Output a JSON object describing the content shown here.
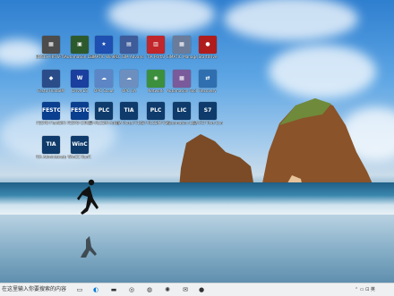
{
  "desktop": {
    "icons": [
      {
        "name": "desktop-icon-1",
        "label": "BOSCH-IRTW-TIA-0",
        "glyph": "▦",
        "color": "#4c4c4c"
      },
      {
        "name": "desktop-icon-2",
        "label": "Automation License",
        "glyph": "▣",
        "color": "#2d5a2d"
      },
      {
        "name": "desktop-icon-3",
        "label": "SIMATIC WinCC",
        "glyph": "★",
        "color": "#1f4fb0"
      },
      {
        "name": "desktop-icon-4",
        "label": "PLC SIM Advanced",
        "glyph": "▤",
        "color": "#3e5b9a"
      },
      {
        "name": "desktop-icon-5",
        "label": "TIA Portal",
        "glyph": "▥",
        "color": "#c0262a"
      },
      {
        "name": "desktop-icon-6",
        "label": "SIMATIC Manager",
        "glyph": "▦",
        "color": "#6b7c9a"
      },
      {
        "name": "desktop-icon-7",
        "label": "Startdrive",
        "glyph": "●",
        "color": "#b01c1c"
      },
      {
        "name": "desktop-icon-8",
        "label": "Festo FluidSIM",
        "glyph": "◆",
        "color": "#2a4d8a"
      },
      {
        "name": "desktop-icon-9",
        "label": "Drive ES",
        "glyph": "W",
        "color": "#1a3f9e"
      },
      {
        "name": "desktop-icon-10",
        "label": "OPC Scout",
        "glyph": "☁",
        "color": "#5d86c6"
      },
      {
        "name": "desktop-icon-11",
        "label": "OPC UA",
        "glyph": "☁",
        "color": "#6d8fc0"
      },
      {
        "name": "desktop-icon-12",
        "label": "Network",
        "glyph": "◉",
        "color": "#3c8f3c"
      },
      {
        "name": "desktop-icon-13",
        "label": "Automation Tool",
        "glyph": "▦",
        "color": "#7a5a9a"
      },
      {
        "name": "desktop-icon-14",
        "label": "Recovery",
        "glyph": "⇄",
        "color": "#2f6fb0"
      },
      {
        "name": "desktop-icon-15",
        "label": "FESTO FluidSIM",
        "glyph": "FESTO",
        "color": "#0a3f8f"
      },
      {
        "name": "desktop-icon-16",
        "label": "FESTO CIROS",
        "glyph": "FESTO",
        "color": "#0a3f8f"
      },
      {
        "name": "desktop-icon-17",
        "label": "S7-PLCSIM Advanced",
        "glyph": "PLC",
        "color": "#0e3b6b"
      },
      {
        "name": "desktop-icon-18",
        "label": "TIA Portal V16",
        "glyph": "TIA",
        "color": "#0e3b6b"
      },
      {
        "name": "desktop-icon-19",
        "label": "S7-PLCSIM V16",
        "glyph": "PLC",
        "color": "#0e3b6b"
      },
      {
        "name": "desktop-icon-20",
        "label": "Automation License Manager",
        "glyph": "LIC",
        "color": "#0e3b6b"
      },
      {
        "name": "desktop-icon-21",
        "label": "S7-PCT Port Config",
        "glyph": "S7",
        "color": "#0e3b6b"
      },
      {
        "name": "desktop-icon-22",
        "label": "TIA Administrator",
        "glyph": "TIA",
        "color": "#0e3b6b"
      },
      {
        "name": "desktop-icon-23",
        "label": "WinCC RunT.",
        "glyph": "WinC",
        "color": "#0e3b6b"
      }
    ]
  },
  "taskbar": {
    "search_text": "在这里输入你要搜索的内容",
    "pinned": [
      {
        "name": "task-view-icon",
        "glyph": "▭"
      },
      {
        "name": "edge-icon",
        "glyph": "◐"
      },
      {
        "name": "file-explorer-icon",
        "glyph": "▬"
      },
      {
        "name": "chrome-icon",
        "glyph": "◎"
      },
      {
        "name": "wechat-icon",
        "glyph": "◍"
      },
      {
        "name": "app-icon",
        "glyph": "✺"
      },
      {
        "name": "mail-icon",
        "glyph": "✉"
      },
      {
        "name": "media-icon",
        "glyph": "●"
      }
    ],
    "tray_text": "⌃ ▭ ⊡ 英",
    "colors": {
      "taskbar_bg": "#eef0f2",
      "accent": "#0078d7"
    }
  }
}
